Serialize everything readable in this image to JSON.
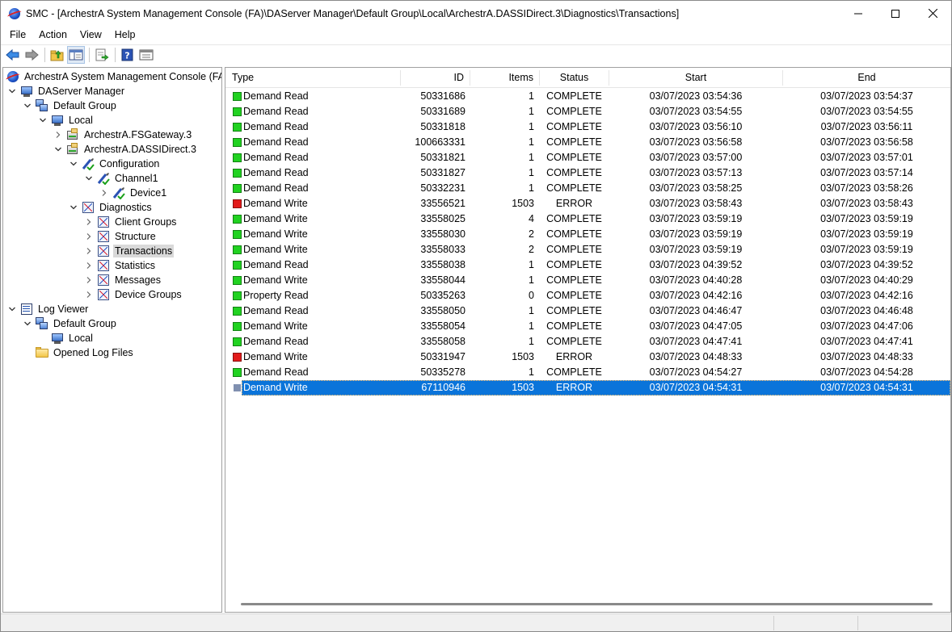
{
  "window": {
    "title": "SMC - [ArchestrA System Management Console (FA)\\DAServer Manager\\Default Group\\Local\\ArchestrA.DASSIDirect.3\\Diagnostics\\Transactions]"
  },
  "menu": [
    "File",
    "Action",
    "View",
    "Help"
  ],
  "toolbar": {
    "buttons": [
      "back-icon",
      "forward-icon",
      "up-folder-icon",
      "show-hide-tree-icon",
      "export-list-icon",
      "help-icon",
      "properties-icon"
    ]
  },
  "tree": [
    {
      "label": "ArchestrA System Management Console (FA)",
      "icon": "smc-icon",
      "level": 0,
      "twisty": "none"
    },
    {
      "label": "DAServer Manager",
      "icon": "computer-icon",
      "level": 0,
      "twisty": "expanded"
    },
    {
      "label": "Default Group",
      "icon": "group-icon",
      "level": 1,
      "twisty": "expanded"
    },
    {
      "label": "Local",
      "icon": "computer-icon",
      "level": 2,
      "twisty": "expanded"
    },
    {
      "label": "ArchestrA.FSGateway.3",
      "icon": "server-icon",
      "level": 3,
      "twisty": "collapsed"
    },
    {
      "label": "ArchestrA.DASSIDirect.3",
      "icon": "server-icon",
      "level": 3,
      "twisty": "expanded"
    },
    {
      "label": "Configuration",
      "icon": "config-icon",
      "level": 4,
      "twisty": "expanded"
    },
    {
      "label": "Channel1",
      "icon": "channel-icon",
      "level": 5,
      "twisty": "expanded"
    },
    {
      "label": "Device1",
      "icon": "device-icon",
      "level": 6,
      "twisty": "collapsed"
    },
    {
      "label": "Diagnostics",
      "icon": "diagnostics-icon",
      "level": 4,
      "twisty": "expanded"
    },
    {
      "label": "Client Groups",
      "icon": "diagnostics-icon",
      "level": 5,
      "twisty": "collapsed"
    },
    {
      "label": "Structure",
      "icon": "diagnostics-icon",
      "level": 5,
      "twisty": "collapsed"
    },
    {
      "label": "Transactions",
      "icon": "diagnostics-icon",
      "level": 5,
      "twisty": "collapsed",
      "selected": true
    },
    {
      "label": "Statistics",
      "icon": "diagnostics-icon",
      "level": 5,
      "twisty": "collapsed"
    },
    {
      "label": "Messages",
      "icon": "diagnostics-icon",
      "level": 5,
      "twisty": "collapsed"
    },
    {
      "label": "Device Groups",
      "icon": "diagnostics-icon",
      "level": 5,
      "twisty": "collapsed"
    },
    {
      "label": "Log Viewer",
      "icon": "log-icon",
      "level": 0,
      "twisty": "expanded"
    },
    {
      "label": "Default Group",
      "icon": "group-icon",
      "level": 1,
      "twisty": "expanded"
    },
    {
      "label": "Local",
      "icon": "computer-icon",
      "level": 2,
      "twisty": "none"
    },
    {
      "label": "Opened Log Files",
      "icon": "folder-icon",
      "level": 1,
      "twisty": "none"
    }
  ],
  "list": {
    "columns": [
      "Type",
      "ID",
      "Items",
      "Status",
      "Start",
      "End"
    ],
    "rows": [
      {
        "type": "Demand Read",
        "id": "50331686",
        "items": "1",
        "status": "COMPLETE",
        "start": "03/07/2023 03:54:36",
        "end": "03/07/2023 03:54:37",
        "state": "ok"
      },
      {
        "type": "Demand Read",
        "id": "50331689",
        "items": "1",
        "status": "COMPLETE",
        "start": "03/07/2023 03:54:55",
        "end": "03/07/2023 03:54:55",
        "state": "ok"
      },
      {
        "type": "Demand Read",
        "id": "50331818",
        "items": "1",
        "status": "COMPLETE",
        "start": "03/07/2023 03:56:10",
        "end": "03/07/2023 03:56:11",
        "state": "ok"
      },
      {
        "type": "Demand Read",
        "id": "100663331",
        "items": "1",
        "status": "COMPLETE",
        "start": "03/07/2023 03:56:58",
        "end": "03/07/2023 03:56:58",
        "state": "ok"
      },
      {
        "type": "Demand Read",
        "id": "50331821",
        "items": "1",
        "status": "COMPLETE",
        "start": "03/07/2023 03:57:00",
        "end": "03/07/2023 03:57:01",
        "state": "ok"
      },
      {
        "type": "Demand Read",
        "id": "50331827",
        "items": "1",
        "status": "COMPLETE",
        "start": "03/07/2023 03:57:13",
        "end": "03/07/2023 03:57:14",
        "state": "ok"
      },
      {
        "type": "Demand Read",
        "id": "50332231",
        "items": "1",
        "status": "COMPLETE",
        "start": "03/07/2023 03:58:25",
        "end": "03/07/2023 03:58:26",
        "state": "ok"
      },
      {
        "type": "Demand Write",
        "id": "33556521",
        "items": "1503",
        "status": "ERROR",
        "start": "03/07/2023 03:58:43",
        "end": "03/07/2023 03:58:43",
        "state": "error"
      },
      {
        "type": "Demand Write",
        "id": "33558025",
        "items": "4",
        "status": "COMPLETE",
        "start": "03/07/2023 03:59:19",
        "end": "03/07/2023 03:59:19",
        "state": "ok"
      },
      {
        "type": "Demand Write",
        "id": "33558030",
        "items": "2",
        "status": "COMPLETE",
        "start": "03/07/2023 03:59:19",
        "end": "03/07/2023 03:59:19",
        "state": "ok"
      },
      {
        "type": "Demand Write",
        "id": "33558033",
        "items": "2",
        "status": "COMPLETE",
        "start": "03/07/2023 03:59:19",
        "end": "03/07/2023 03:59:19",
        "state": "ok"
      },
      {
        "type": "Demand Read",
        "id": "33558038",
        "items": "1",
        "status": "COMPLETE",
        "start": "03/07/2023 04:39:52",
        "end": "03/07/2023 04:39:52",
        "state": "ok"
      },
      {
        "type": "Demand Write",
        "id": "33558044",
        "items": "1",
        "status": "COMPLETE",
        "start": "03/07/2023 04:40:28",
        "end": "03/07/2023 04:40:29",
        "state": "ok"
      },
      {
        "type": "Property Read",
        "id": "50335263",
        "items": "0",
        "status": "COMPLETE",
        "start": "03/07/2023 04:42:16",
        "end": "03/07/2023 04:42:16",
        "state": "ok"
      },
      {
        "type": "Demand Read",
        "id": "33558050",
        "items": "1",
        "status": "COMPLETE",
        "start": "03/07/2023 04:46:47",
        "end": "03/07/2023 04:46:48",
        "state": "ok"
      },
      {
        "type": "Demand Write",
        "id": "33558054",
        "items": "1",
        "status": "COMPLETE",
        "start": "03/07/2023 04:47:05",
        "end": "03/07/2023 04:47:06",
        "state": "ok"
      },
      {
        "type": "Demand Read",
        "id": "33558058",
        "items": "1",
        "status": "COMPLETE",
        "start": "03/07/2023 04:47:41",
        "end": "03/07/2023 04:47:41",
        "state": "ok"
      },
      {
        "type": "Demand Write",
        "id": "50331947",
        "items": "1503",
        "status": "ERROR",
        "start": "03/07/2023 04:48:33",
        "end": "03/07/2023 04:48:33",
        "state": "error"
      },
      {
        "type": "Demand Read",
        "id": "50335278",
        "items": "1",
        "status": "COMPLETE",
        "start": "03/07/2023 04:54:27",
        "end": "03/07/2023 04:54:28",
        "state": "ok"
      },
      {
        "type": "Demand Write",
        "id": "67110946",
        "items": "1503",
        "status": "ERROR",
        "start": "03/07/2023 04:54:31",
        "end": "03/07/2023 04:54:31",
        "state": "error",
        "selected": true
      }
    ]
  },
  "colors": {
    "selection": "#0a74da",
    "ok": "#21d221",
    "error": "#e21b1b"
  }
}
